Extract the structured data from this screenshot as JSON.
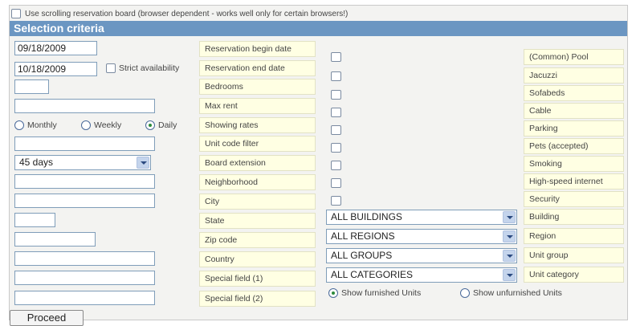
{
  "top_option": {
    "label": "Use scrolling reservation board (browser dependent - works well only for certain browsers!)"
  },
  "section_title": "Selection criteria",
  "fields": {
    "begin_date": "09/18/2009",
    "end_date": "10/18/2009",
    "board_extension": "45 days"
  },
  "strict_availability_label": "Strict availability",
  "rate_options": [
    "Monthly",
    "Weekly",
    "Daily"
  ],
  "rate_selected": "Daily",
  "left_labels": [
    "Reservation begin date",
    "Reservation end date",
    "Bedrooms",
    "Max rent",
    "Showing rates",
    "Unit code filter",
    "Board extension",
    "Neighborhood",
    "City",
    "State",
    "Zip code",
    "Country",
    "Special field (1)",
    "Special field (2)"
  ],
  "amenity_labels": [
    "(Common) Pool",
    "Jacuzzi",
    "Sofabeds",
    "Cable",
    "Parking",
    "Pets (accepted)",
    "Smoking",
    "High-speed internet",
    "Security"
  ],
  "dropdowns": [
    {
      "value": "ALL BUILDINGS",
      "label": "Building"
    },
    {
      "value": "ALL REGIONS",
      "label": "Region"
    },
    {
      "value": "ALL GROUPS",
      "label": "Unit group"
    },
    {
      "value": "ALL CATEGORIES",
      "label": "Unit category"
    }
  ],
  "furnished_options": [
    "Show furnished Units",
    "Show unfurnished Units"
  ],
  "furnished_selected": "Show furnished Units",
  "proceed_label": "Proceed"
}
